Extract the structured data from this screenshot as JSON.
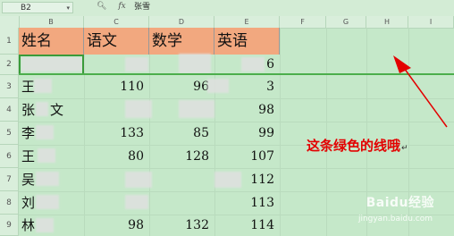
{
  "formula_bar": {
    "cell_ref": "B2",
    "zoom_icon": "magnifier-icon",
    "fx_label": "fx",
    "value": "张雪"
  },
  "columns": [
    "B",
    "C",
    "D",
    "E",
    "F",
    "G",
    "H",
    "I"
  ],
  "rows": [
    "1",
    "2",
    "3",
    "4",
    "5",
    "6",
    "7",
    "8",
    "9"
  ],
  "table": {
    "headers": [
      "姓名",
      "语文",
      "数学",
      "英语"
    ],
    "rows": [
      {
        "name": "",
        "c": "",
        "d": "",
        "e": "6"
      },
      {
        "name": "王",
        "c": "110",
        "d": "96",
        "e": "3"
      },
      {
        "name": "张",
        "c": "",
        "d": "",
        "e": "98",
        "name_tail": "文"
      },
      {
        "name": "李",
        "c": "133",
        "d": "85",
        "e": "99"
      },
      {
        "name": "王",
        "c": "80",
        "d": "128",
        "e": "107"
      },
      {
        "name": "吴",
        "c": "",
        "d": "",
        "e": "112"
      },
      {
        "name": "刘",
        "c": "",
        "d": "",
        "e": "113"
      },
      {
        "name": "林",
        "c": "98",
        "d": "132",
        "e": "114"
      }
    ]
  },
  "annotation": {
    "text": "这条绿色的线哦",
    "mark": "↵"
  },
  "watermark": {
    "brand": "Baidu经验",
    "url": "jingyan.baidu.com"
  },
  "colors": {
    "sheet_bg": "#c5e8c9",
    "header_fill": "#f2a87f",
    "green_line": "#4cae4c",
    "annotation": "#e30000"
  }
}
